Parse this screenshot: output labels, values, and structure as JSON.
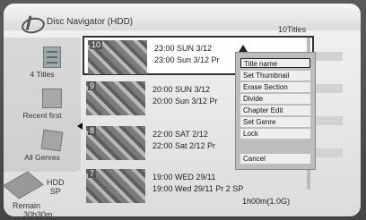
{
  "header": {
    "title": "Disc Navigator (HDD)",
    "count": "10Titles"
  },
  "sidebar": {
    "items": [
      {
        "label": "4 Titles",
        "icon": "list-icon"
      },
      {
        "label": "Recent first",
        "icon": "sort-icon"
      },
      {
        "label": "All Genres",
        "icon": "genre-icon"
      }
    ],
    "hdd_label": "HDD",
    "mode_label": "SP",
    "remain_label": "Remain",
    "remain_value": "30h30m"
  },
  "titles": [
    {
      "num": "10",
      "line1": "23:00 SUN 3/12",
      "line2": "23:00  Sun  3/12  Pr",
      "line3": ""
    },
    {
      "num": "9",
      "line1": "20:00 SUN 3/12",
      "line2": "20:00   Sun  3/12  Pr",
      "line3": ""
    },
    {
      "num": "8",
      "line1": "22:00 SAT 2/12",
      "line2": "22:00   Sat  2/12  Pr",
      "line3": ""
    },
    {
      "num": "7",
      "line1": "19:00 WED 29/11",
      "line2": "19:00  Wed  29/11  Pr 2  SP",
      "line3": "1h00m(1.0G)"
    }
  ],
  "menu": {
    "items": [
      "Title name",
      "Set Thumbnail",
      "Erase Section",
      "Divide",
      "Chapter Edit",
      "Set Genre",
      "Lock",
      "Cancel"
    ]
  }
}
